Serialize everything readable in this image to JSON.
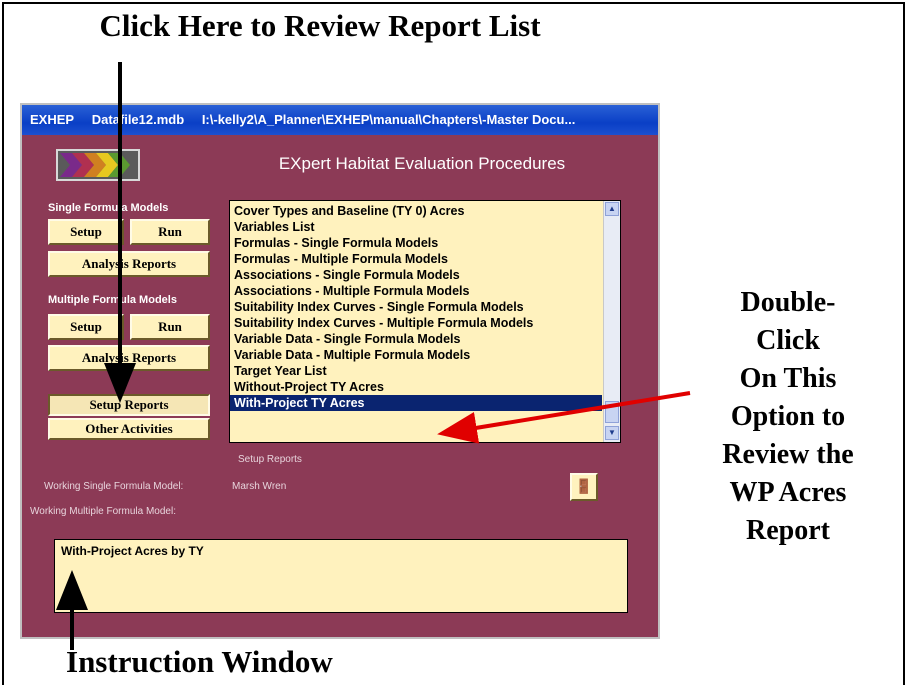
{
  "annotations": {
    "top": "Click Here to Review Report List",
    "right": [
      "Double-",
      "Click",
      "On This",
      "Option to",
      "Review the",
      "WP Acres",
      "Report"
    ],
    "bottom": "Instruction Window"
  },
  "titlebar": {
    "app": "EXHEP",
    "file": "Datafile12.mdb",
    "path": "I:\\-kelly2\\A_Planner\\EXHEP\\manual\\Chapters\\-Master Docu..."
  },
  "app_title": "EXpert Habitat Evaluation Procedures",
  "single": {
    "label": "Single Formula Models",
    "setup": "Setup",
    "run": "Run",
    "analysis": "Analysis Reports"
  },
  "multiple": {
    "label": "Multiple Formula Models",
    "setup": "Setup",
    "run": "Run",
    "analysis": "Analysis Reports"
  },
  "setup_reports_button": "Setup Reports",
  "other_activities_button": "Other Activities",
  "report_list": {
    "items": [
      "Cover Types and Baseline (TY 0) Acres",
      "Variables List",
      "Formulas - Single Formula Models",
      "Formulas - Multiple Formula Models",
      "Associations - Single Formula Models",
      "Associations - Multiple Formula Models",
      "Suitability Index Curves - Single Formula Models",
      "Suitability Index Curves - Multiple Formula Models",
      "Variable Data - Single Formula Models",
      "Variable Data - Multiple Formula Models",
      "Target Year List",
      "Without-Project TY Acres",
      "With-Project TY Acres"
    ],
    "selected": "With-Project TY Acres"
  },
  "list_caption": "Setup Reports",
  "working_single_label": "Working Single Formula Model:",
  "working_single_value": "Marsh Wren",
  "working_multiple_label": "Working Multiple Formula Model:",
  "instruction_text": "With-Project Acres by TY"
}
